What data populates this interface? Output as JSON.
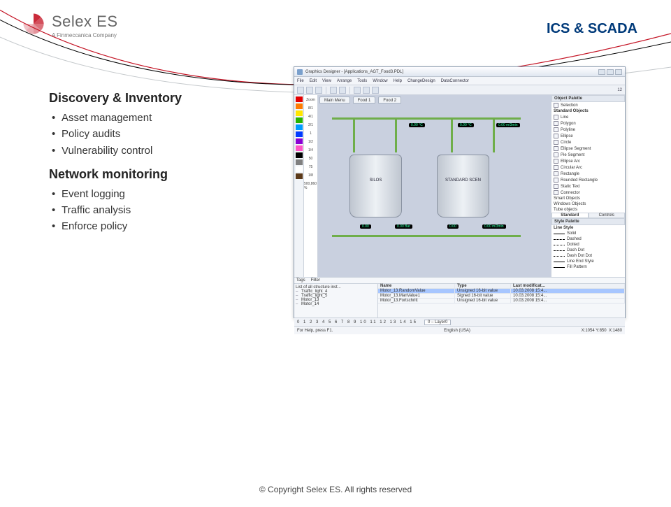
{
  "brand": {
    "name": "Selex ES",
    "subtitle": "A Finmeccanica Company"
  },
  "page_title": "ICS & SCADA",
  "content": {
    "section1": {
      "heading": "Discovery & Inventory",
      "items": [
        "Asset management",
        "Policy audits",
        "Vulnerability control"
      ]
    },
    "section2": {
      "heading": "Network monitoring",
      "items": [
        "Event logging",
        "Traffic analysis",
        "Enforce policy"
      ]
    }
  },
  "scada": {
    "window_title": "Graphics Designer - [Applications_AGT_Food3.PDL]",
    "menu": [
      "File",
      "Edit",
      "View",
      "Arrange",
      "Tools",
      "Window",
      "Help",
      "ChangeDesign",
      "DataConnector"
    ],
    "size_label": "12",
    "zoom_marks": [
      "Zoom",
      "8/1",
      "4/1",
      "2/1",
      "1",
      "1/2",
      "1/4",
      "50",
      "75",
      "1/8",
      "500,860 %"
    ],
    "tabs": [
      "Main Menu",
      "Food 1",
      "Food 2"
    ],
    "tanks": {
      "left_label": "SILOS",
      "right_label": "STANDARD SCEN"
    },
    "readouts": [
      "0.00 °C",
      "0.00 °C",
      "0.00 m/3min",
      "0.00",
      "0.00 Bar",
      "0.00",
      "0.00 m/3min"
    ],
    "right_panel": {
      "header": "Object Palette",
      "selection": "Selection",
      "standard": {
        "label": "Standard Objects",
        "items": [
          "Line",
          "Polygon",
          "Polyline",
          "Ellipse",
          "Circle",
          "Ellipse Segment",
          "Pie Segment",
          "Ellipse Arc",
          "Circular Arc",
          "Rectangle",
          "Rounded Rectangle",
          "Static Text",
          "Connector"
        ]
      },
      "smart": "Smart Objects",
      "windows": "Windows Objects",
      "tube": "Tube objects",
      "tabs": [
        "Standard",
        "Controls"
      ],
      "style_header": "Style Palette",
      "line_style": "Line Style",
      "patterns": [
        "Solid",
        "Dashed",
        "Dotted",
        "Dash Dot",
        "Dash Dot Dot",
        "Line End Style",
        "Fill Pattern"
      ]
    },
    "bottom": {
      "tags_label": "Tags",
      "filter_label": "Filter",
      "tree_label": "List of all structure inst...",
      "tree_items": [
        "Traffic_light_4",
        "Traffic_light_5",
        "Motor_13",
        "Motor_14"
      ],
      "columns": [
        "Name",
        "Type",
        "Last modificat..."
      ],
      "rows": [
        {
          "name": "Motor_13.RandomValue",
          "type": "Unsigned 16-bit value",
          "mod": "10.03.2008 15:4..."
        },
        {
          "name": "Motor_13.ManValue1",
          "type": "Signed 16-bit value",
          "mod": "10.03.2008 15:4..."
        },
        {
          "name": "Motor_13.Fortschritt",
          "type": "Unsigned 16-bit value",
          "mod": "10.03.2008 15:4..."
        }
      ]
    },
    "ruler_nums": "0 1 2 3 4 5 6 7 8 9 10 11 12 13 14 15",
    "layer_label": "0 – Layer0",
    "status": {
      "left": "For Help, press F1.",
      "center": "English (USA)",
      "right_x": "X:1054 Y:850",
      "right_y": "X:1480"
    }
  },
  "palette_colors": [
    "#e30000",
    "#ff7b00",
    "#ffe600",
    "#27b400",
    "#009cff",
    "#003aff",
    "#8a00d4",
    "#ff54c7",
    "#000000",
    "#808080",
    "#ffffff",
    "#5c3a1a"
  ],
  "footer": "© Copyright Selex ES. All rights reserved"
}
